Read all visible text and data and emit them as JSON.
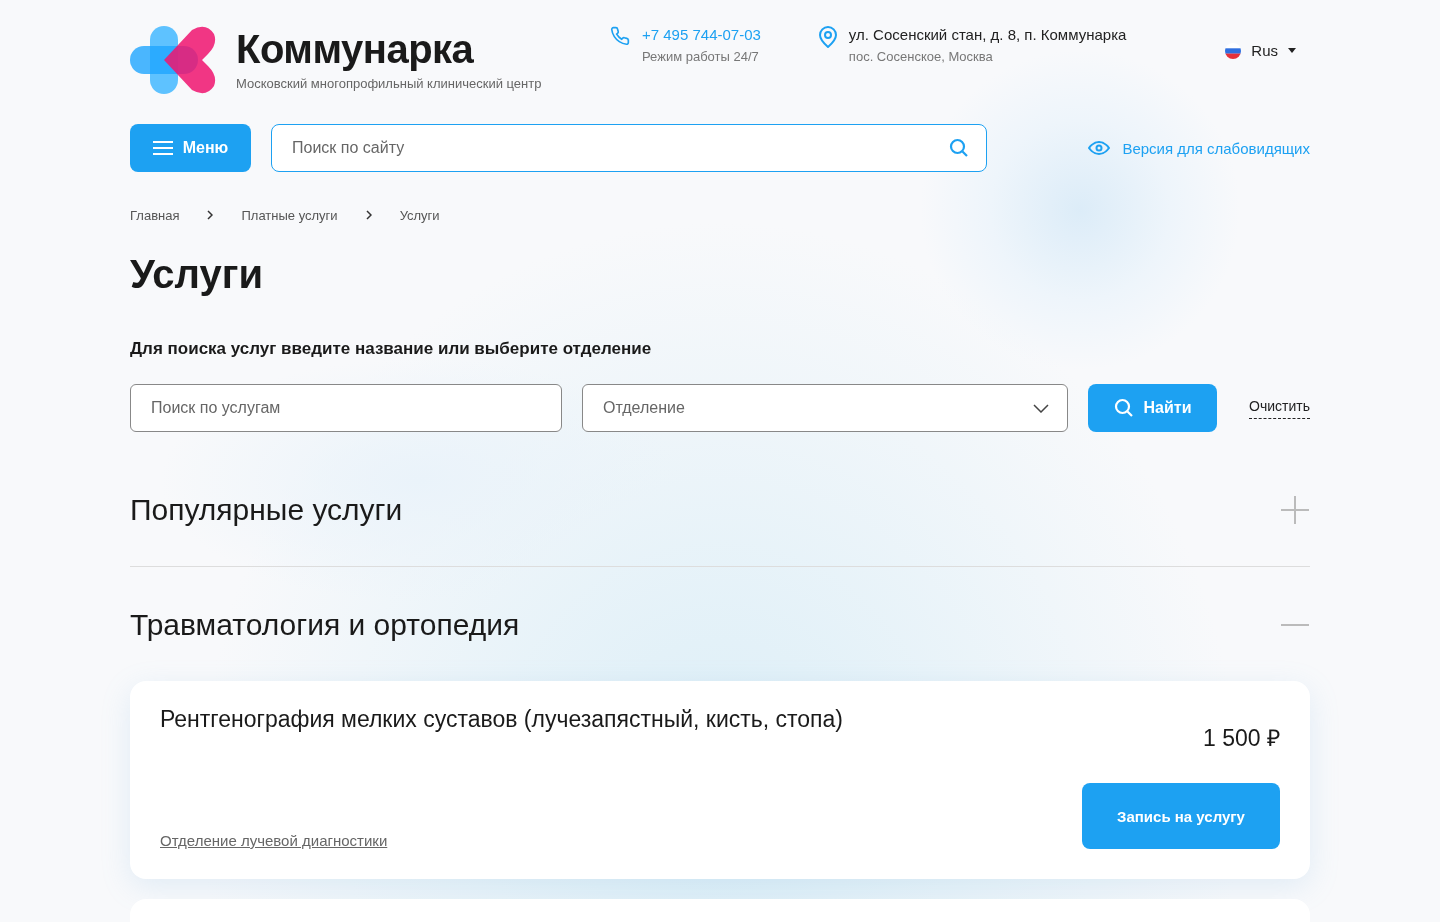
{
  "header": {
    "brand": "Коммунарка",
    "tagline": "Московский многопрофильный клинический центр",
    "phone": "+7 495 744-07-03",
    "hours": "Режим работы 24/7",
    "address": "ул. Сосенский стан, д. 8, п. Коммунарка",
    "address_sub": "пос. Сосенское, Москва",
    "language": "Rus"
  },
  "nav": {
    "menu_button": "Меню",
    "search": {
      "placeholder": "Поиск по сайту"
    },
    "accessibility_link": "Версия для слабовидящих"
  },
  "breadcrumbs": [
    "Главная",
    "Платные услуги",
    "Услуги"
  ],
  "page_title": "Услуги",
  "filter": {
    "hint": "Для поиска услуг введите название или выберите отделение",
    "search": {
      "placeholder": "Поиск по услугам"
    },
    "department": {
      "placeholder": "Отделение"
    },
    "find_button": "Найти",
    "clear_link": "Очистить"
  },
  "sections": [
    {
      "title": "Популярные услуги",
      "expanded": false
    },
    {
      "title": "Травматология и ортопедия",
      "expanded": true,
      "services": [
        {
          "name": "Рентгенография мелких суставов (лучезапястный, кисть, стопа)",
          "price": "1 500 ₽",
          "department": "Отделение лучевой диагностики",
          "button": "Запись на услугу"
        }
      ]
    }
  ]
}
